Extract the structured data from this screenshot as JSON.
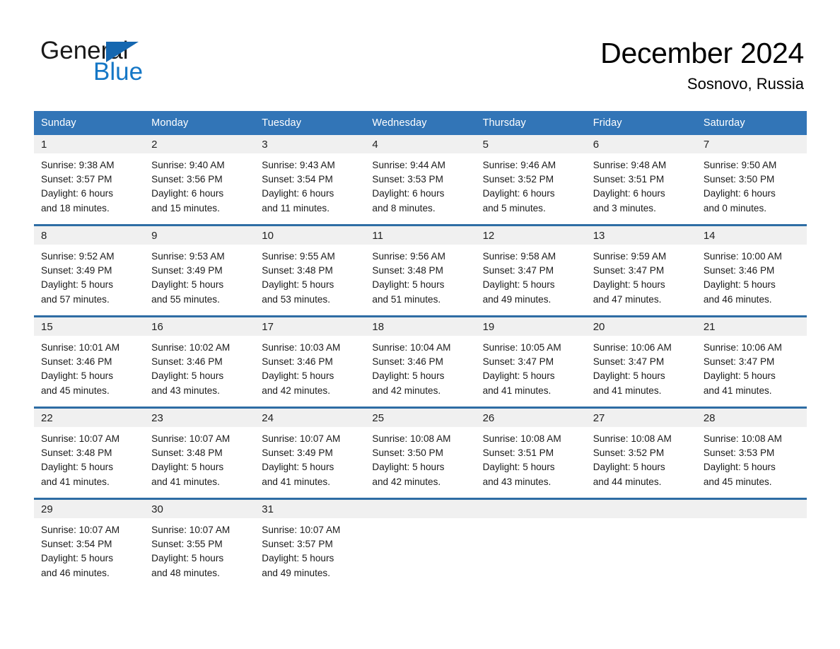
{
  "brand": {
    "name_part1": "General",
    "name_part2": "Blue",
    "triangle_color": "#1567b0",
    "blue_color": "#1577c6"
  },
  "header": {
    "month_title": "December 2024",
    "location": "Sosnovo, Russia"
  },
  "theme": {
    "header_row_bg": "#3275b7",
    "week_divider": "#2e6da4",
    "daynum_band_bg": "#f0f0f0",
    "page_bg": "#ffffff",
    "text": "#1a1a1a"
  },
  "calendar": {
    "weekday_headers": [
      "Sunday",
      "Monday",
      "Tuesday",
      "Wednesday",
      "Thursday",
      "Friday",
      "Saturday"
    ],
    "weeks": [
      [
        {
          "day": "1",
          "sunrise": "Sunrise: 9:38 AM",
          "sunset": "Sunset: 3:57 PM",
          "daylight_line1": "Daylight: 6 hours",
          "daylight_line2": "and 18 minutes."
        },
        {
          "day": "2",
          "sunrise": "Sunrise: 9:40 AM",
          "sunset": "Sunset: 3:56 PM",
          "daylight_line1": "Daylight: 6 hours",
          "daylight_line2": "and 15 minutes."
        },
        {
          "day": "3",
          "sunrise": "Sunrise: 9:43 AM",
          "sunset": "Sunset: 3:54 PM",
          "daylight_line1": "Daylight: 6 hours",
          "daylight_line2": "and 11 minutes."
        },
        {
          "day": "4",
          "sunrise": "Sunrise: 9:44 AM",
          "sunset": "Sunset: 3:53 PM",
          "daylight_line1": "Daylight: 6 hours",
          "daylight_line2": "and 8 minutes."
        },
        {
          "day": "5",
          "sunrise": "Sunrise: 9:46 AM",
          "sunset": "Sunset: 3:52 PM",
          "daylight_line1": "Daylight: 6 hours",
          "daylight_line2": "and 5 minutes."
        },
        {
          "day": "6",
          "sunrise": "Sunrise: 9:48 AM",
          "sunset": "Sunset: 3:51 PM",
          "daylight_line1": "Daylight: 6 hours",
          "daylight_line2": "and 3 minutes."
        },
        {
          "day": "7",
          "sunrise": "Sunrise: 9:50 AM",
          "sunset": "Sunset: 3:50 PM",
          "daylight_line1": "Daylight: 6 hours",
          "daylight_line2": "and 0 minutes."
        }
      ],
      [
        {
          "day": "8",
          "sunrise": "Sunrise: 9:52 AM",
          "sunset": "Sunset: 3:49 PM",
          "daylight_line1": "Daylight: 5 hours",
          "daylight_line2": "and 57 minutes."
        },
        {
          "day": "9",
          "sunrise": "Sunrise: 9:53 AM",
          "sunset": "Sunset: 3:49 PM",
          "daylight_line1": "Daylight: 5 hours",
          "daylight_line2": "and 55 minutes."
        },
        {
          "day": "10",
          "sunrise": "Sunrise: 9:55 AM",
          "sunset": "Sunset: 3:48 PM",
          "daylight_line1": "Daylight: 5 hours",
          "daylight_line2": "and 53 minutes."
        },
        {
          "day": "11",
          "sunrise": "Sunrise: 9:56 AM",
          "sunset": "Sunset: 3:48 PM",
          "daylight_line1": "Daylight: 5 hours",
          "daylight_line2": "and 51 minutes."
        },
        {
          "day": "12",
          "sunrise": "Sunrise: 9:58 AM",
          "sunset": "Sunset: 3:47 PM",
          "daylight_line1": "Daylight: 5 hours",
          "daylight_line2": "and 49 minutes."
        },
        {
          "day": "13",
          "sunrise": "Sunrise: 9:59 AM",
          "sunset": "Sunset: 3:47 PM",
          "daylight_line1": "Daylight: 5 hours",
          "daylight_line2": "and 47 minutes."
        },
        {
          "day": "14",
          "sunrise": "Sunrise: 10:00 AM",
          "sunset": "Sunset: 3:46 PM",
          "daylight_line1": "Daylight: 5 hours",
          "daylight_line2": "and 46 minutes."
        }
      ],
      [
        {
          "day": "15",
          "sunrise": "Sunrise: 10:01 AM",
          "sunset": "Sunset: 3:46 PM",
          "daylight_line1": "Daylight: 5 hours",
          "daylight_line2": "and 45 minutes."
        },
        {
          "day": "16",
          "sunrise": "Sunrise: 10:02 AM",
          "sunset": "Sunset: 3:46 PM",
          "daylight_line1": "Daylight: 5 hours",
          "daylight_line2": "and 43 minutes."
        },
        {
          "day": "17",
          "sunrise": "Sunrise: 10:03 AM",
          "sunset": "Sunset: 3:46 PM",
          "daylight_line1": "Daylight: 5 hours",
          "daylight_line2": "and 42 minutes."
        },
        {
          "day": "18",
          "sunrise": "Sunrise: 10:04 AM",
          "sunset": "Sunset: 3:46 PM",
          "daylight_line1": "Daylight: 5 hours",
          "daylight_line2": "and 42 minutes."
        },
        {
          "day": "19",
          "sunrise": "Sunrise: 10:05 AM",
          "sunset": "Sunset: 3:47 PM",
          "daylight_line1": "Daylight: 5 hours",
          "daylight_line2": "and 41 minutes."
        },
        {
          "day": "20",
          "sunrise": "Sunrise: 10:06 AM",
          "sunset": "Sunset: 3:47 PM",
          "daylight_line1": "Daylight: 5 hours",
          "daylight_line2": "and 41 minutes."
        },
        {
          "day": "21",
          "sunrise": "Sunrise: 10:06 AM",
          "sunset": "Sunset: 3:47 PM",
          "daylight_line1": "Daylight: 5 hours",
          "daylight_line2": "and 41 minutes."
        }
      ],
      [
        {
          "day": "22",
          "sunrise": "Sunrise: 10:07 AM",
          "sunset": "Sunset: 3:48 PM",
          "daylight_line1": "Daylight: 5 hours",
          "daylight_line2": "and 41 minutes."
        },
        {
          "day": "23",
          "sunrise": "Sunrise: 10:07 AM",
          "sunset": "Sunset: 3:48 PM",
          "daylight_line1": "Daylight: 5 hours",
          "daylight_line2": "and 41 minutes."
        },
        {
          "day": "24",
          "sunrise": "Sunrise: 10:07 AM",
          "sunset": "Sunset: 3:49 PM",
          "daylight_line1": "Daylight: 5 hours",
          "daylight_line2": "and 41 minutes."
        },
        {
          "day": "25",
          "sunrise": "Sunrise: 10:08 AM",
          "sunset": "Sunset: 3:50 PM",
          "daylight_line1": "Daylight: 5 hours",
          "daylight_line2": "and 42 minutes."
        },
        {
          "day": "26",
          "sunrise": "Sunrise: 10:08 AM",
          "sunset": "Sunset: 3:51 PM",
          "daylight_line1": "Daylight: 5 hours",
          "daylight_line2": "and 43 minutes."
        },
        {
          "day": "27",
          "sunrise": "Sunrise: 10:08 AM",
          "sunset": "Sunset: 3:52 PM",
          "daylight_line1": "Daylight: 5 hours",
          "daylight_line2": "and 44 minutes."
        },
        {
          "day": "28",
          "sunrise": "Sunrise: 10:08 AM",
          "sunset": "Sunset: 3:53 PM",
          "daylight_line1": "Daylight: 5 hours",
          "daylight_line2": "and 45 minutes."
        }
      ],
      [
        {
          "day": "29",
          "sunrise": "Sunrise: 10:07 AM",
          "sunset": "Sunset: 3:54 PM",
          "daylight_line1": "Daylight: 5 hours",
          "daylight_line2": "and 46 minutes."
        },
        {
          "day": "30",
          "sunrise": "Sunrise: 10:07 AM",
          "sunset": "Sunset: 3:55 PM",
          "daylight_line1": "Daylight: 5 hours",
          "daylight_line2": "and 48 minutes."
        },
        {
          "day": "31",
          "sunrise": "Sunrise: 10:07 AM",
          "sunset": "Sunset: 3:57 PM",
          "daylight_line1": "Daylight: 5 hours",
          "daylight_line2": "and 49 minutes."
        },
        {
          "day": "",
          "sunrise": "",
          "sunset": "",
          "daylight_line1": "",
          "daylight_line2": ""
        },
        {
          "day": "",
          "sunrise": "",
          "sunset": "",
          "daylight_line1": "",
          "daylight_line2": ""
        },
        {
          "day": "",
          "sunrise": "",
          "sunset": "",
          "daylight_line1": "",
          "daylight_line2": ""
        },
        {
          "day": "",
          "sunrise": "",
          "sunset": "",
          "daylight_line1": "",
          "daylight_line2": ""
        }
      ]
    ]
  }
}
